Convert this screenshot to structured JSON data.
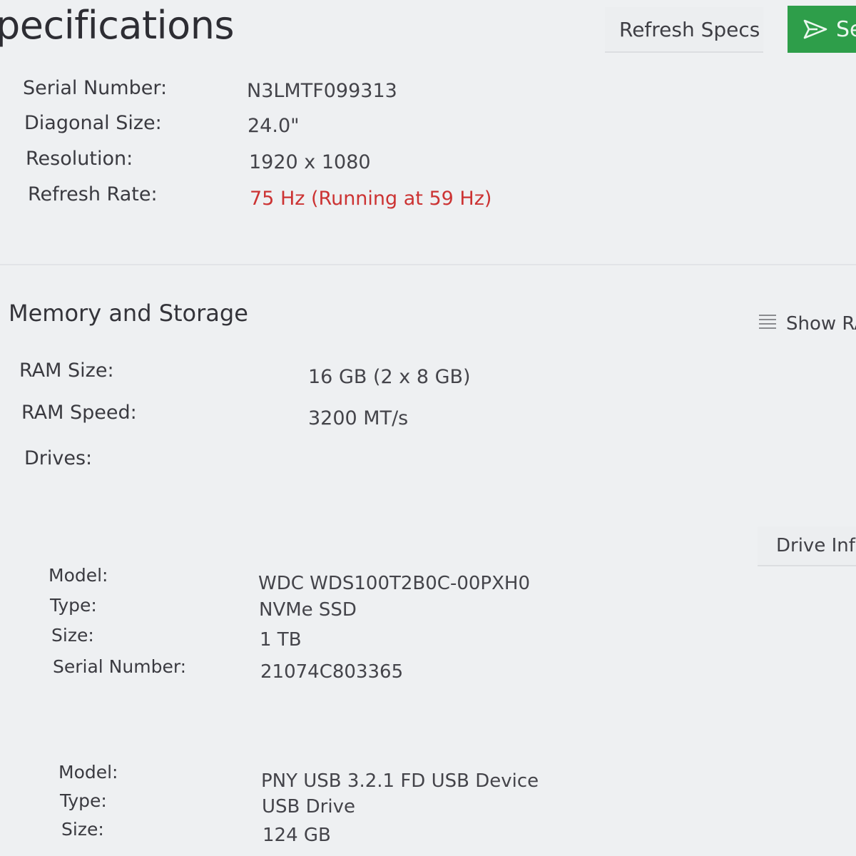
{
  "header": {
    "title": "pecifications",
    "refresh_label": "Refresh Specs",
    "send_label": "Se"
  },
  "display": {
    "rows": [
      {
        "label": "Serial Number:",
        "value": "N3LMTF099313"
      },
      {
        "label": "Diagonal Size:",
        "value": "24.0\""
      },
      {
        "label": "Resolution:",
        "value": "1920 x 1080"
      },
      {
        "label": "Refresh Rate:",
        "value": "75 Hz (Running at 59 Hz)"
      }
    ],
    "warning_color": "#cc3333"
  },
  "memory": {
    "title": "Memory and Storage",
    "show_ram_label": "Show RA",
    "rows": [
      {
        "label": "RAM Size:",
        "value": "16 GB (2 x 8 GB)"
      },
      {
        "label": "RAM Speed:",
        "value": "3200 MT/s"
      }
    ],
    "drives_label": "Drives:",
    "drive_info_label": "Drive Info",
    "drives": [
      {
        "rows": [
          {
            "label": "Model:",
            "value": "WDC WDS100T2B0C-00PXH0"
          },
          {
            "label": "Type:",
            "value": "NVMe SSD"
          },
          {
            "label": "Size:",
            "value": "1 TB"
          },
          {
            "label": "Serial Number:",
            "value": "21074C803365"
          }
        ]
      },
      {
        "rows": [
          {
            "label": "Model:",
            "value": "PNY USB 3.2.1 FD USB Device"
          },
          {
            "label": "Type:",
            "value": "USB Drive"
          },
          {
            "label": "Size:",
            "value": "124 GB"
          }
        ]
      }
    ]
  },
  "icons": {
    "send": "send-icon",
    "list": "list-icon"
  },
  "colors": {
    "accent_green": "#2e9e4a",
    "background": "#eef0f2"
  }
}
